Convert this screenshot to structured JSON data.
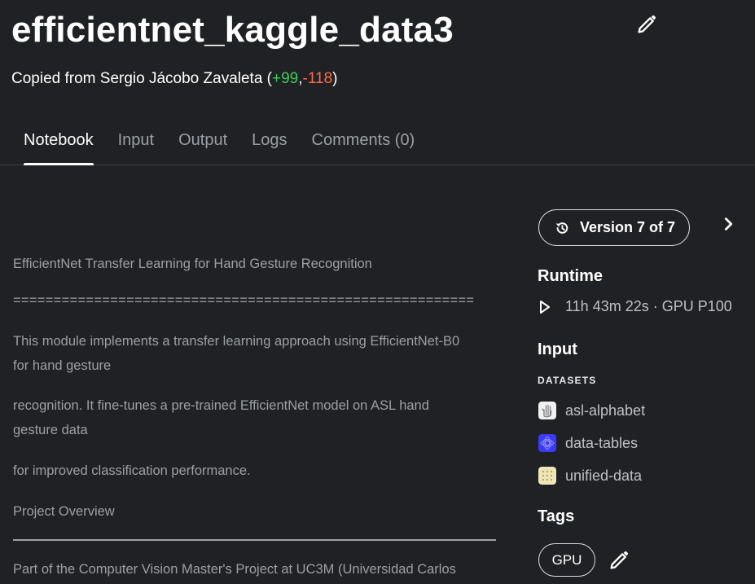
{
  "header": {
    "title": "efficientnet_kaggle_data3",
    "subtitle_prefix": "Copied from Sergio Jácobo Zavaleta (",
    "votes_up": "+99",
    "votes_sep": ",",
    "votes_down": "-118",
    "subtitle_suffix": ")"
  },
  "tabs": [
    {
      "label": "Notebook",
      "active": true
    },
    {
      "label": "Input"
    },
    {
      "label": "Output"
    },
    {
      "label": "Logs"
    },
    {
      "label": "Comments (0)"
    }
  ],
  "notebook": {
    "p1": "EfficientNet Transfer Learning for Hand Gesture Recognition",
    "p2": "=========================================================",
    "p3a": "This module implements a transfer learning approach using EfficientNet-B0",
    "p3b": "for hand gesture",
    "p4a": "recognition. It fine-tunes a pre-trained EfficientNet model on ASL hand",
    "p4b": "gesture data",
    "p5": "for improved classification performance.",
    "p6": "Project Overview",
    "p7": "Part of the Computer Vision Master's Project at UC3M (Universidad Carlos"
  },
  "sidebar": {
    "version_label": "Version 7 of 7",
    "runtime_title": "Runtime",
    "runtime_value": "11h 43m 22s · GPU P100",
    "input_title": "Input",
    "datasets_heading": "DATASETS",
    "datasets": [
      {
        "name": "asl-alphabet",
        "icon": "hand-sketch-thumbnail"
      },
      {
        "name": "data-tables",
        "icon": "blue-pattern-thumbnail"
      },
      {
        "name": "unified-data",
        "icon": "dotted-grid-thumbnail"
      }
    ],
    "tags_title": "Tags",
    "tags": [
      "GPU"
    ]
  },
  "colors": {
    "background": "#202124",
    "vote_up": "#3ccf5b",
    "vote_down": "#ff6a4d",
    "muted_text": "#9aa0a6"
  }
}
